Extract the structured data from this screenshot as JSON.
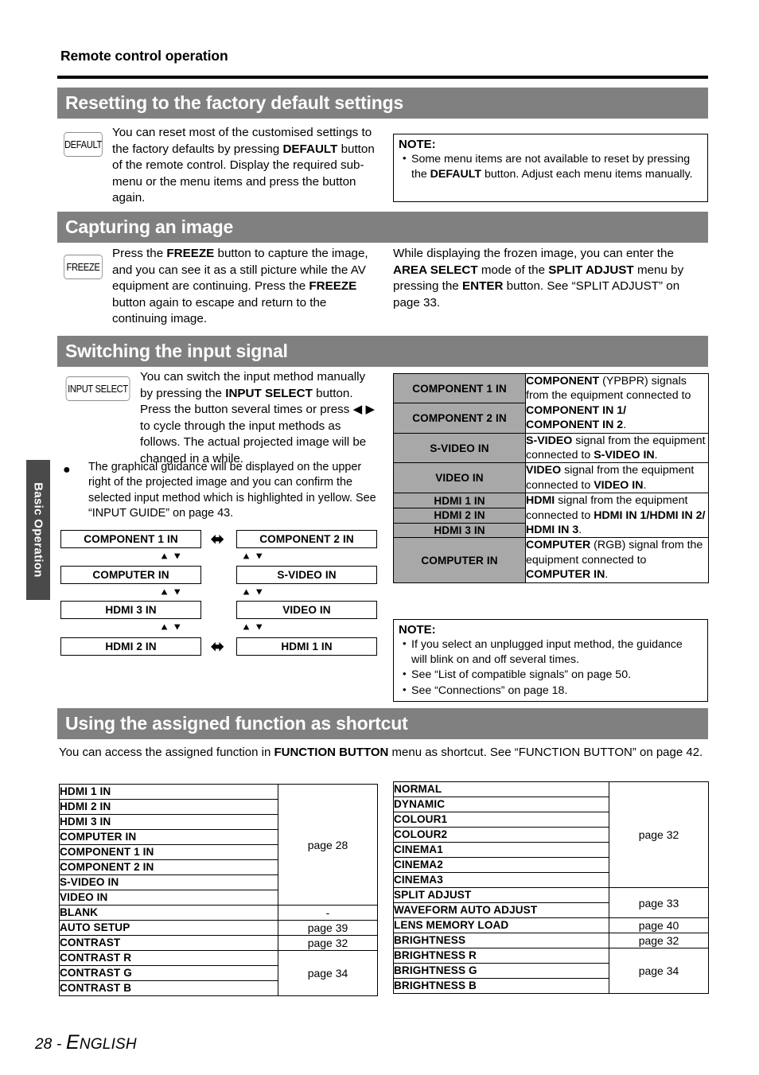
{
  "running_head": "Remote control operation",
  "side_tab": {
    "label": "Basic Operation"
  },
  "sections": {
    "reset": {
      "title": "Resetting to the factory default settings",
      "key_label": "DEFAULT",
      "body_html": "You can reset most of the customised settings to the factory defaults by pressing <b>DEFAULT</b> button of the remote control. Display the required sub-menu or the menu items and press the button again.",
      "note": {
        "title": "NOTE:",
        "items_html": [
          "Some menu items are not available to reset by pressing the <b>DEFAULT</b> button. Adjust each menu items manually."
        ]
      }
    },
    "capture": {
      "title": "Capturing an image",
      "key_label": "FREEZE",
      "body_left_html": "Press the <b>FREEZE</b> button to capture the image, and you can see it as a still picture while the AV equipment are continuing. Press the <b>FREEZE</b> button again to escape and return to the continuing image.",
      "body_right_html": "While displaying the frozen image, you can enter the <b>AREA SELECT</b> mode of the <b>SPLIT ADJUST</b> menu by pressing the <b>ENTER</b> button. See &ldquo;SPLIT ADJUST&rdquo; on page 33."
    },
    "switching": {
      "title": "Switching the input signal",
      "key_label": "INPUT SELECT",
      "body_html": "You can switch the input method manually by pressing the <b>INPUT SELECT</b> button. Press the button several times or press &#9664; &#9654; to cycle through the input methods as follows. The actual projected image will be changed in a while.",
      "bullet_html": "The graphical guidance will be displayed on the upper right of the projected image and you can confirm the selected input method which is highlighted in yellow. See &ldquo;INPUT GUIDE&rdquo; on page 43.",
      "cycle": {
        "left_column": [
          "COMPONENT 1 IN",
          "COMPUTER IN",
          "HDMI 3 IN",
          "HDMI 2 IN"
        ],
        "right_column": [
          "COMPONENT 2 IN",
          "S-VIDEO IN",
          "VIDEO IN",
          "HDMI 1 IN"
        ]
      },
      "signal_table": [
        {
          "labels": [
            "COMPONENT 1 IN",
            "COMPONENT 2 IN"
          ],
          "desc_html": "<b>COMPONENT</b> (YPBPR) signals from the equipment connected to <b>COMPONENT IN 1/</b><br><b>COMPONENT IN 2</b>."
        },
        {
          "labels": [
            "S-VIDEO IN"
          ],
          "desc_html": "<b>S-VIDEO</b> signal from the equipment connected to <b>S-VIDEO IN</b>."
        },
        {
          "labels": [
            "VIDEO IN"
          ],
          "desc_html": "<b>VIDEO</b> signal from the equipment connected to <b>VIDEO IN</b>."
        },
        {
          "labels": [
            "HDMI 1 IN",
            "HDMI 2 IN",
            "HDMI 3 IN"
          ],
          "desc_html": "<b>HDMI</b> signal from the equipment connected to <b>HDMI IN 1/HDMI IN 2/<br>HDMI IN 3</b>."
        },
        {
          "labels": [
            "COMPUTER IN"
          ],
          "desc_html": "<b>COMPUTER</b> (RGB) signal from the equipment connected to <b>COMPUTER IN</b>."
        }
      ],
      "note": {
        "title": "NOTE:",
        "items_html": [
          "If you select an unplugged input method, the guidance will blink on and off several times.",
          "See &ldquo;List of compatible signals&rdquo; on page 50.",
          "See &ldquo;Connections&rdquo; on page 18."
        ]
      }
    },
    "shortcut": {
      "title": "Using the assigned function as shortcut",
      "intro_html": "You can access the assigned function in <b>FUNCTION BUTTON</b> menu as shortcut. See &ldquo;FUNCTION BUTTON&rdquo; on page 42.",
      "table_left": [
        {
          "items": [
            "HDMI 1 IN",
            "HDMI 2 IN",
            "HDMI 3 IN",
            "COMPUTER IN",
            "COMPONENT 1 IN",
            "COMPONENT 2 IN",
            "S-VIDEO IN",
            "VIDEO IN"
          ],
          "page": "page 28"
        },
        {
          "items": [
            "BLANK"
          ],
          "page": "-"
        },
        {
          "items": [
            "AUTO SETUP"
          ],
          "page": "page 39"
        },
        {
          "items": [
            "CONTRAST"
          ],
          "page": "page 32"
        },
        {
          "items": [
            "CONTRAST R",
            "CONTRAST G",
            "CONTRAST B"
          ],
          "page": "page 34"
        }
      ],
      "table_right": [
        {
          "items": [
            "NORMAL",
            "DYNAMIC",
            "COLOUR1",
            "COLOUR2",
            "CINEMA1",
            "CINEMA2",
            "CINEMA3"
          ],
          "page": "page 32"
        },
        {
          "items": [
            "SPLIT ADJUST",
            "WAVEFORM AUTO ADJUST"
          ],
          "page": "page 33"
        },
        {
          "items": [
            "LENS MEMORY LOAD"
          ],
          "page": "page 40"
        },
        {
          "items": [
            "BRIGHTNESS"
          ],
          "page": "page 32"
        },
        {
          "items": [
            "BRIGHTNESS R",
            "BRIGHTNESS G",
            "BRIGHTNESS B"
          ],
          "page": "page 34"
        }
      ]
    }
  },
  "footer": {
    "page_number": "28 - ",
    "language_first": "E",
    "language_rest": "NGLISH"
  },
  "colors": {
    "section_bar": "#808080",
    "side_tab": "#4a4a4a",
    "table_label_gray": "#a8a8a8"
  }
}
